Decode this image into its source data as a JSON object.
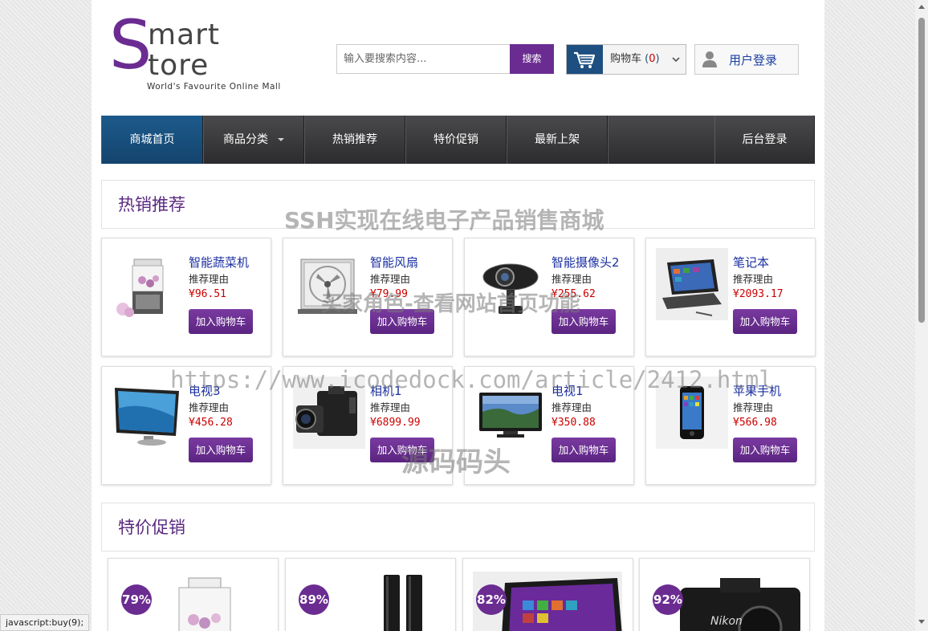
{
  "logo": {
    "letter": "S",
    "line1": "mart",
    "line2": "tore",
    "tagline": "World's Favourite Online Mall"
  },
  "search": {
    "placeholder": "输入要搜索内容...",
    "button": "搜索"
  },
  "cart": {
    "label": "购物车",
    "count": "0",
    "icon": "shopping-cart-icon"
  },
  "login": {
    "label": "用户登录",
    "icon": "user-icon"
  },
  "nav": {
    "home": "商城首页",
    "categories": "商品分类",
    "hot": "热销推荐",
    "sale": "特价促销",
    "new": "最新上架",
    "admin": "后台登录"
  },
  "sections": {
    "hot": "热销推荐",
    "sale": "特价促销"
  },
  "products": [
    {
      "name": "智能蔬菜机",
      "reason": "推荐理由",
      "price": "¥96.51",
      "button": "加入购物车",
      "icon": "juicer-icon"
    },
    {
      "name": "智能风扇",
      "reason": "推荐理由",
      "price": "¥79.99",
      "button": "加入购物车",
      "icon": "fan-icon"
    },
    {
      "name": "智能摄像头2",
      "reason": "推荐理由",
      "price": "¥255.62",
      "button": "加入购物车",
      "icon": "webcam-icon"
    },
    {
      "name": "笔记本",
      "reason": "推荐理由",
      "price": "¥2093.17",
      "button": "加入购物车",
      "icon": "laptop-icon"
    },
    {
      "name": "电视3",
      "reason": "推荐理由",
      "price": "¥456.28",
      "button": "加入购物车",
      "icon": "monitor-icon"
    },
    {
      "name": "相机1",
      "reason": "推荐理由",
      "price": "¥6899.99",
      "button": "加入购物车",
      "icon": "camera-icon"
    },
    {
      "name": "电视1",
      "reason": "推荐理由",
      "price": "¥350.88",
      "button": "加入购物车",
      "icon": "tv-icon"
    },
    {
      "name": "苹果手机",
      "reason": "推荐理由",
      "price": "¥566.98",
      "button": "加入购物车",
      "icon": "phone-icon"
    }
  ],
  "sale_items": [
    {
      "badge": "79%",
      "icon": "juicer-icon"
    },
    {
      "badge": "89%",
      "icon": "speaker-icon"
    },
    {
      "badge": "82%",
      "icon": "tablet-icon"
    },
    {
      "badge": "92%",
      "icon": "camera-icon"
    }
  ],
  "watermarks": {
    "title": "SSH实现在线电子产品销售商城",
    "role": "买家角色-查看网站首页功能",
    "url": "https://www.icodedock.com/article/2412.html",
    "brand": "源码码头"
  },
  "status_bar": "javascript:buy(9);"
}
